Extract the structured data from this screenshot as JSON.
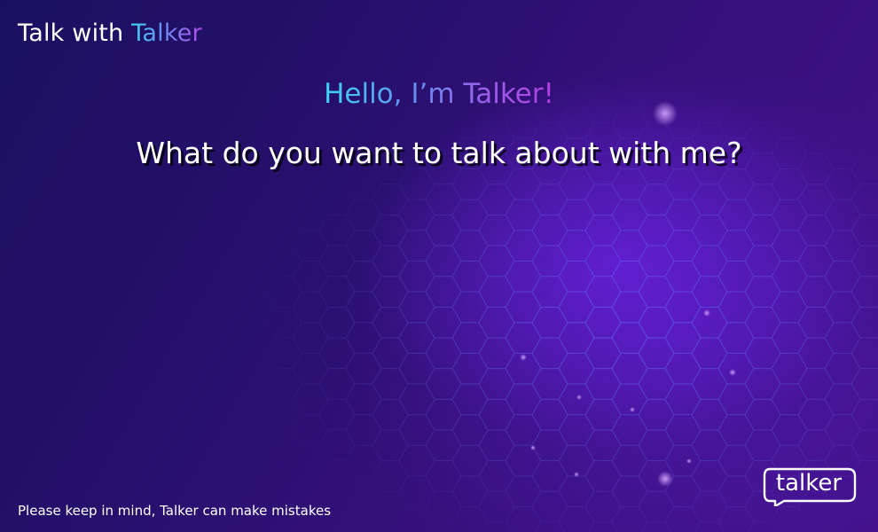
{
  "header": {
    "title_prefix": "Talk with ",
    "title_accent": "Talker"
  },
  "main": {
    "greeting": "Hello, I’m Talker!",
    "question": "What do you want to talk about with me?"
  },
  "footer": {
    "disclaimer": "Please keep in mind, Talker can make mistakes"
  },
  "logo": {
    "text": "talker",
    "icon": "speech-bubble-logo"
  },
  "colors": {
    "background_dark": "#1b1060",
    "background_purple": "#43128a",
    "accent_cyan": "#3fd3f2",
    "accent_violet": "#b03fe0",
    "text": "#ffffff"
  }
}
